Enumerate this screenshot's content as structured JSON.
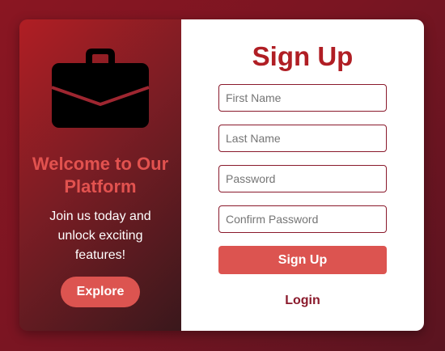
{
  "colors": {
    "background": "#7a1522",
    "accent": "#dc5450",
    "title_red": "#b01e24",
    "welcome_red": "#e2524f",
    "border_red": "#8a1a2c"
  },
  "left_panel": {
    "icon": "briefcase-icon",
    "title": "Welcome to Our Platform",
    "text": "Join us today and unlock exciting features!",
    "explore_label": "Explore"
  },
  "form": {
    "title": "Sign Up",
    "first_name": {
      "placeholder": "First Name",
      "value": ""
    },
    "last_name": {
      "placeholder": "Last Name",
      "value": ""
    },
    "password": {
      "placeholder": "Password",
      "value": ""
    },
    "confirm_password": {
      "placeholder": "Confirm Password",
      "value": ""
    },
    "submit_label": "Sign Up",
    "login_label": "Login"
  }
}
